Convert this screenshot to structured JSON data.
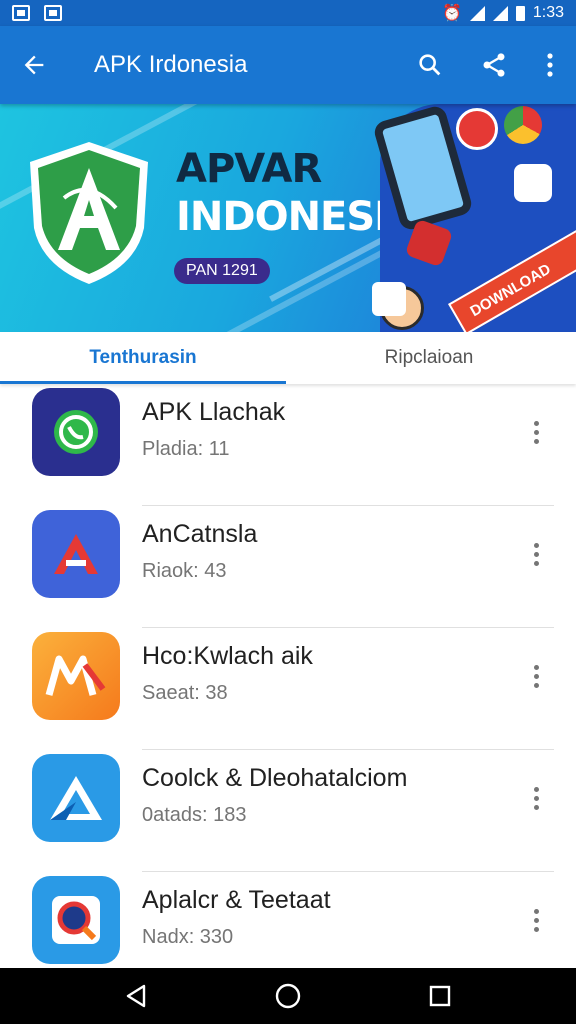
{
  "status_bar": {
    "time": "1:33"
  },
  "toolbar": {
    "title": "APK Irdonesia"
  },
  "banner": {
    "title_line1": "APVAR",
    "title_line2": "INDONESIA",
    "pill": "PAN 1291",
    "ribbon": "DOWNLOAD"
  },
  "tabs": [
    {
      "label": "Tenthurasin",
      "active": true
    },
    {
      "label": "Ripclaioan",
      "active": false
    }
  ],
  "apps": [
    {
      "name": "APK Llachak",
      "meta": "Pladia: 11",
      "icon": "whatsapp-icon",
      "color": "#2a2f8f"
    },
    {
      "name": "AnCatnsla",
      "meta": "Riaok: 43",
      "icon": "letter-a-icon",
      "color": "#3f63d9"
    },
    {
      "name": "Hco:Kwlach aik",
      "meta": "Saeat: 38",
      "icon": "mx-logo-icon",
      "color": "#f29a1c"
    },
    {
      "name": "Coolck & Dleohatalciom",
      "meta": "0atads: 183",
      "icon": "triangle-drive-icon",
      "color": "#2a9ae6"
    },
    {
      "name": "Aplalcr & Teetaat",
      "meta": "Nadx: 330",
      "icon": "search-lens-icon",
      "color": "#2a9ae6"
    }
  ],
  "colors": {
    "primary": "#1976d2",
    "status": "#1565c0"
  }
}
